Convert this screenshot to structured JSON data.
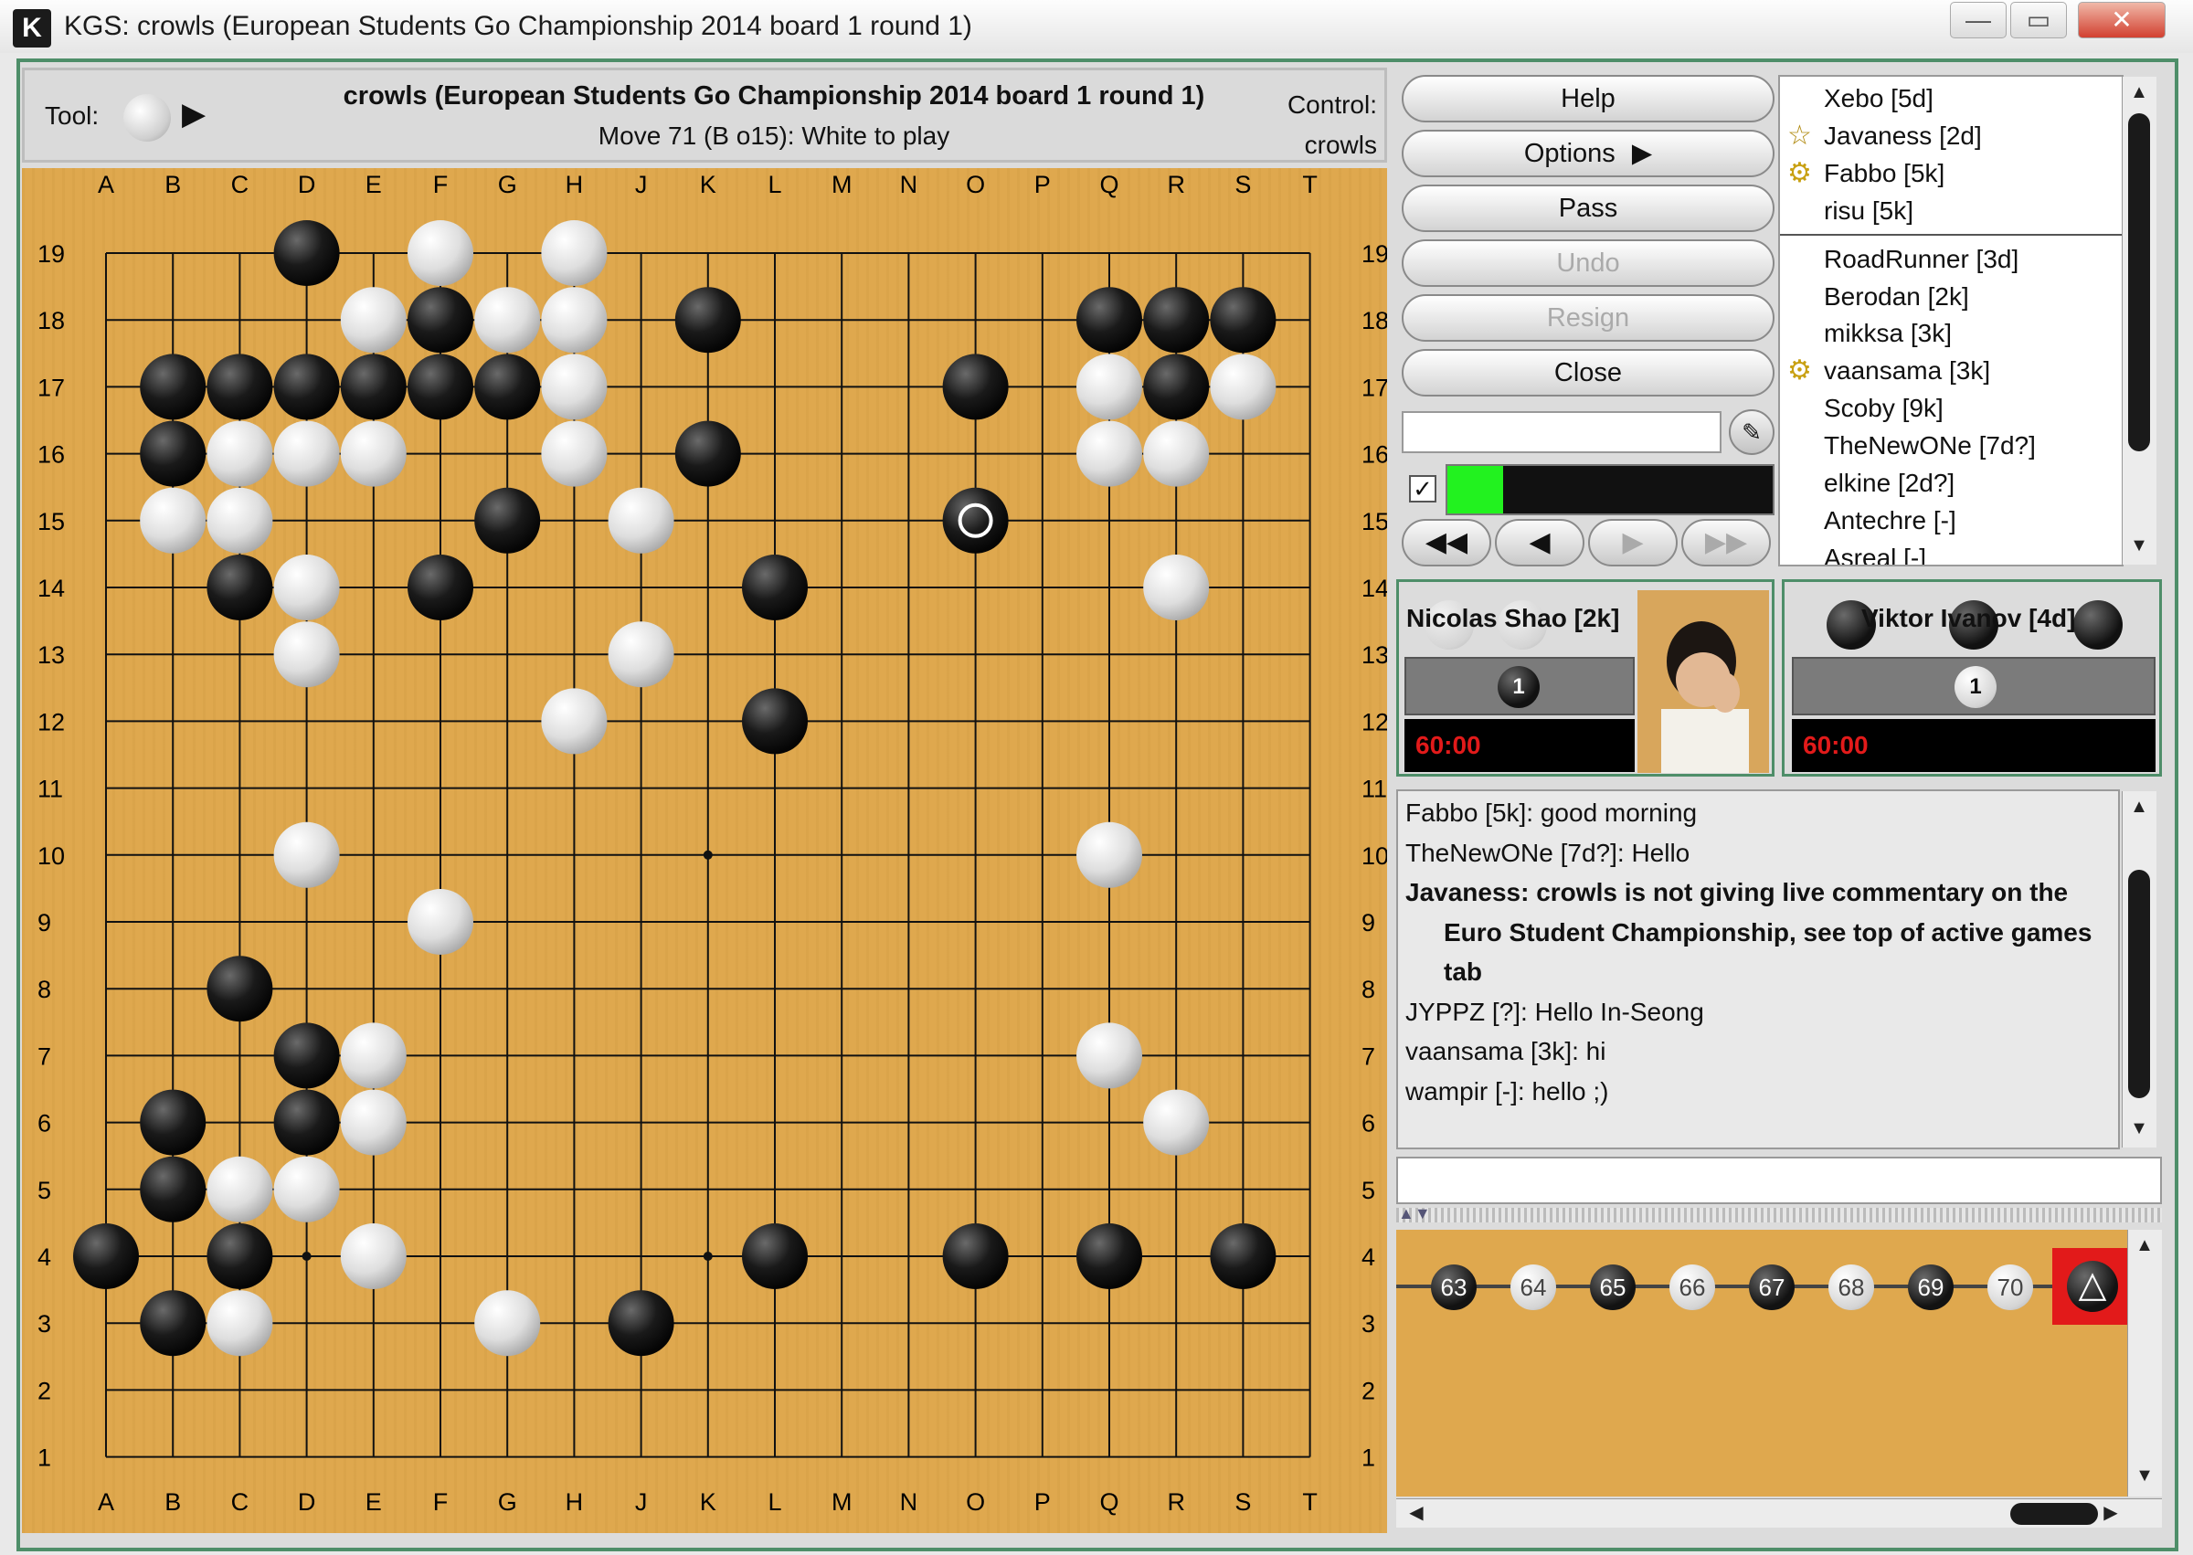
{
  "window": {
    "icon_letter": "K",
    "title": "KGS: crowls (European Students Go Championship 2014 board 1 round 1)",
    "min": "—",
    "max": "▭",
    "close": "✕"
  },
  "board_header": {
    "tool_label": "Tool:",
    "game_title": "crowls (European Students Go Championship 2014 board 1 round 1)",
    "move_status": "Move 71 (B o15): White to play",
    "control_label": "Control:",
    "control_user": "crowls"
  },
  "board": {
    "columns": [
      "A",
      "B",
      "C",
      "D",
      "E",
      "F",
      "G",
      "H",
      "J",
      "K",
      "L",
      "M",
      "N",
      "O",
      "P",
      "Q",
      "R",
      "S",
      "T"
    ],
    "rows": [
      19,
      18,
      17,
      16,
      15,
      14,
      13,
      12,
      11,
      10,
      9,
      8,
      7,
      6,
      5,
      4,
      3,
      2,
      1
    ],
    "black_stones": [
      "D19",
      "F18",
      "K18",
      "Q18",
      "R18",
      "S18",
      "B17",
      "C17",
      "D17",
      "E17",
      "F17",
      "G17",
      "O17",
      "R17",
      "B16",
      "K16",
      "G15",
      "O15",
      "C14",
      "F14",
      "L14",
      "L12",
      "C8",
      "D7",
      "B6",
      "D6",
      "B5",
      "A4",
      "C4",
      "L4",
      "O4",
      "Q4",
      "S4",
      "B3",
      "J3"
    ],
    "white_stones": [
      "F19",
      "H19",
      "E18",
      "G18",
      "H18",
      "H17",
      "Q17",
      "S17",
      "C16",
      "D16",
      "E16",
      "H16",
      "Q16",
      "R16",
      "B15",
      "C15",
      "J15",
      "D14",
      "R14",
      "D13",
      "J13",
      "H12",
      "D10",
      "Q10",
      "F9",
      "E7",
      "Q7",
      "E6",
      "R6",
      "C5",
      "D5",
      "E4",
      "C3",
      "G3"
    ],
    "last_move": "O15",
    "colors": {
      "wood": "#dfa84e",
      "line": "#111111"
    }
  },
  "buttons": {
    "help": "Help",
    "options": "Options",
    "pass": "Pass",
    "undo": "Undo",
    "resign": "Resign",
    "close": "Close"
  },
  "users": [
    {
      "name": "Xebo [5d]",
      "icon": ""
    },
    {
      "name": "Javaness [2d]",
      "icon": "star-icon"
    },
    {
      "name": "Fabbo [5k]",
      "icon": "ring-icon"
    },
    {
      "name": "risu [5k]",
      "icon": ""
    },
    {
      "name": "RoadRunner [3d]",
      "icon": ""
    },
    {
      "name": "Berodan [2k]",
      "icon": ""
    },
    {
      "name": "mikksa [3k]",
      "icon": ""
    },
    {
      "name": "vaansama [3k]",
      "icon": "ring-icon"
    },
    {
      "name": "Scoby [9k]",
      "icon": ""
    },
    {
      "name": "TheNewONe [7d?]",
      "icon": ""
    },
    {
      "name": "elkine [2d?]",
      "icon": ""
    },
    {
      "name": "Antechre [-]",
      "icon": ""
    },
    {
      "name": "Asreal [-]",
      "icon": ""
    }
  ],
  "progress": {
    "fill_percent": 17,
    "color": "#22f21f"
  },
  "nav": {
    "first": "◀◀",
    "prev": "◀",
    "next": "▶",
    "last": "▶▶"
  },
  "players": {
    "white": {
      "name": "Nicolas Shao [2k]",
      "captures": "1",
      "clock": "60:00"
    },
    "black": {
      "name": "Viktor Ivanov [4d]",
      "captures": "1",
      "clock": "60:00"
    }
  },
  "chat": [
    {
      "text": "Fabbo [5k]: good morning",
      "bold": false
    },
    {
      "text": "TheNewONe [7d?]: Hello",
      "bold": false
    },
    {
      "text": "Javaness: crowls is not giving live commentary on the",
      "bold": true
    },
    {
      "text": "Euro Student Championship, see top of active games",
      "bold": true
    },
    {
      "text": "tab",
      "bold": true
    },
    {
      "text": "JYPPZ [?]: Hello In-Seong",
      "bold": false
    },
    {
      "text": "vaansama [3k]: hi",
      "bold": false
    },
    {
      "text": "wampir [-]: hello ;)",
      "bold": false
    }
  ],
  "move_tree": {
    "nodes": [
      {
        "n": "63",
        "color": "black"
      },
      {
        "n": "64",
        "color": "white"
      },
      {
        "n": "65",
        "color": "black"
      },
      {
        "n": "66",
        "color": "white"
      },
      {
        "n": "67",
        "color": "black"
      },
      {
        "n": "68",
        "color": "white"
      },
      {
        "n": "69",
        "color": "black"
      },
      {
        "n": "70",
        "color": "white"
      }
    ],
    "current_marker": "△",
    "highlight_color": "#e21a1a"
  }
}
